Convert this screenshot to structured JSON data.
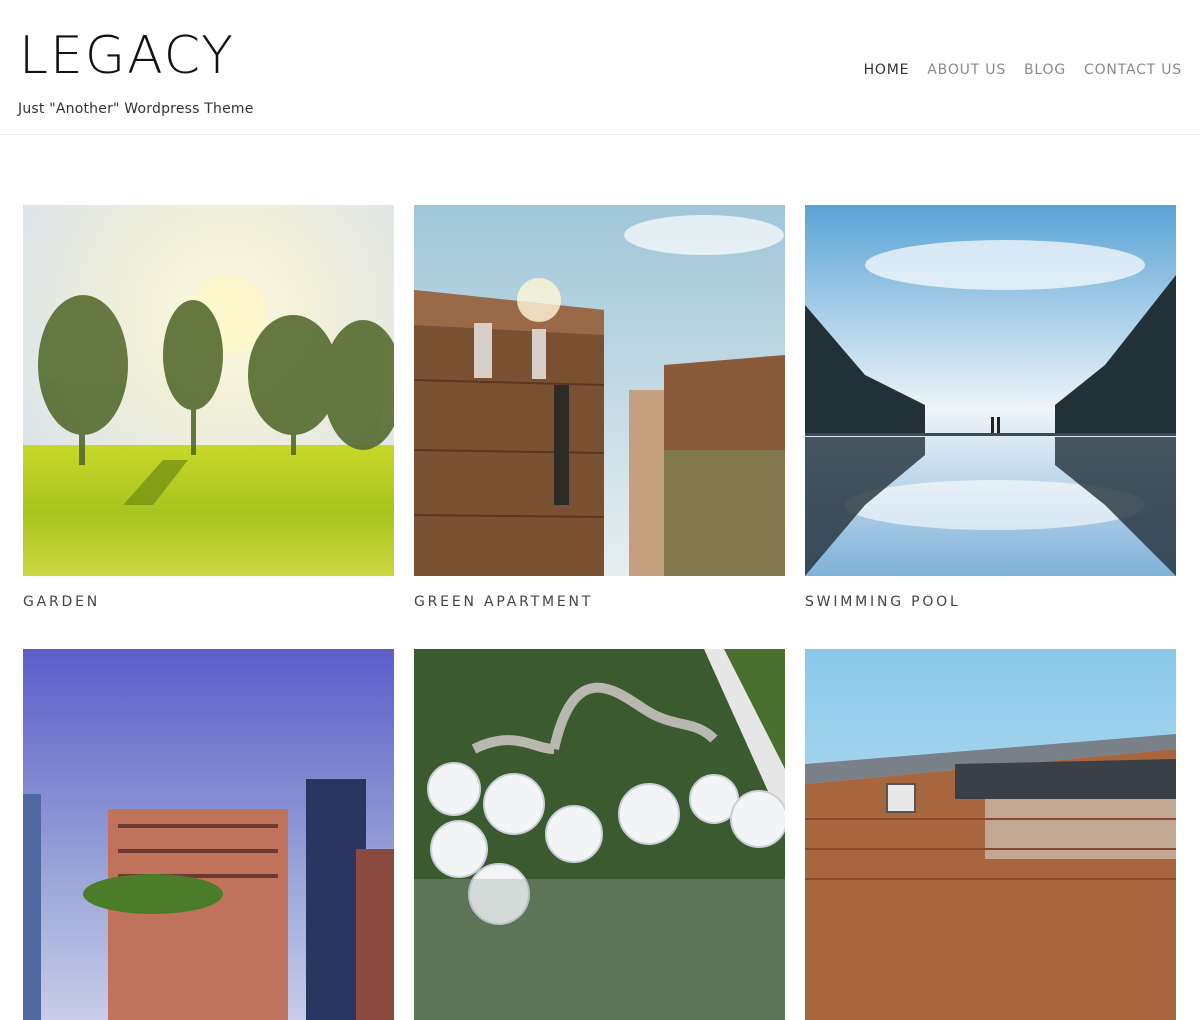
{
  "site": {
    "title": "LEGACY",
    "tagline": "Just \"Another\" Wordpress Theme"
  },
  "nav": {
    "items": [
      {
        "label": "HOME",
        "active": true
      },
      {
        "label": "ABOUT US",
        "active": false
      },
      {
        "label": "BLOG",
        "active": false
      },
      {
        "label": "CONTACT US",
        "active": false
      }
    ]
  },
  "portfolio": {
    "items": [
      {
        "title": "GARDEN",
        "image": "garden-photo"
      },
      {
        "title": "GREEN APARTMENT",
        "image": "apartment-photo"
      },
      {
        "title": "SWIMMING POOL",
        "image": "pool-photo"
      },
      {
        "title": "",
        "image": "city-towers-photo"
      },
      {
        "title": "",
        "image": "aerial-park-photo"
      },
      {
        "title": "",
        "image": "modern-house-photo"
      }
    ]
  },
  "colors": {
    "nav_active": "#333333",
    "nav_inactive": "#8a8a8a",
    "divider": "#ececec"
  }
}
